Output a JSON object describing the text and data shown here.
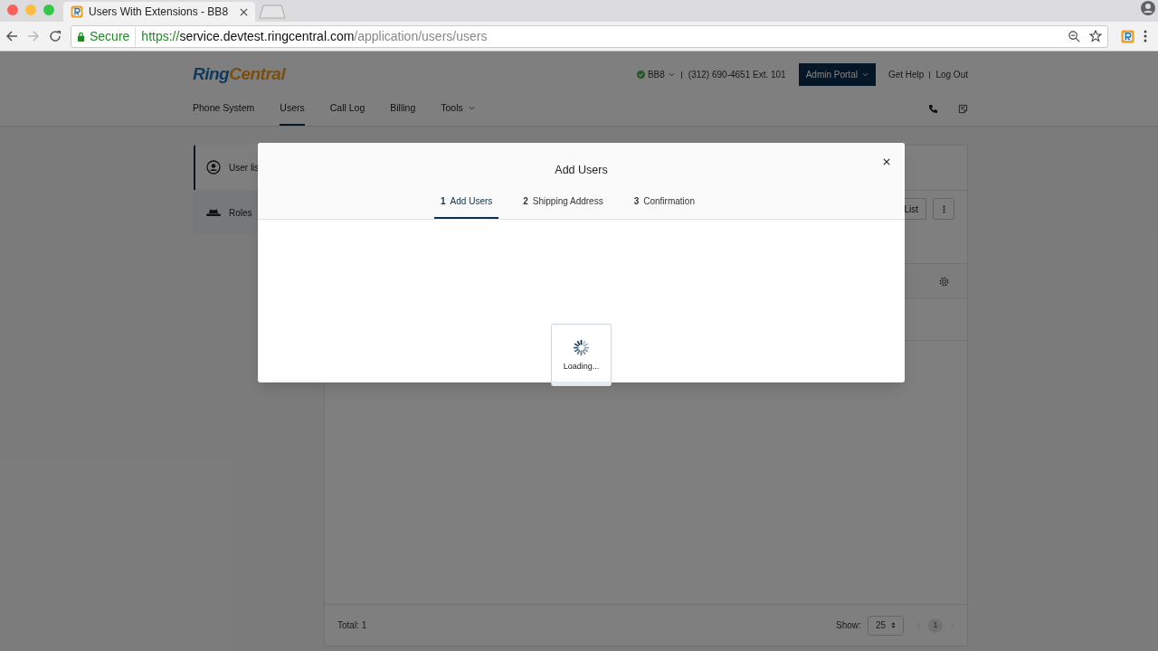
{
  "browser": {
    "tab_title": "Users With Extensions - BB8",
    "secure": "Secure",
    "url_host": "https://service.devtest.ringcentral.com",
    "url_path": "/application/users/users"
  },
  "header": {
    "logo": [
      "Ring",
      "Central"
    ],
    "account": "BB8",
    "phone": "(312) 690-4651 Ext. 101",
    "portal_button": "Admin Portal",
    "links": [
      "Get Help",
      "Log Out"
    ]
  },
  "nav": [
    {
      "label": "Phone System",
      "selected": false,
      "has_menu": false
    },
    {
      "label": "Users",
      "selected": true,
      "has_menu": false
    },
    {
      "label": "Call Log",
      "selected": false,
      "has_menu": false
    },
    {
      "label": "Billing",
      "selected": false,
      "has_menu": false
    },
    {
      "label": "Tools",
      "selected": false,
      "has_menu": true
    }
  ],
  "sidebar": [
    {
      "label": "User lis",
      "selected": true
    },
    {
      "label": "Roles",
      "selected": false
    }
  ],
  "toolbar": {
    "list_button": "List"
  },
  "footer": {
    "total": "Total: 1",
    "show_label": "Show:",
    "page_size": "25",
    "page": "1"
  },
  "modal": {
    "title": "Add Users",
    "steps": [
      {
        "number": "1",
        "label": "Add Users",
        "selected": true
      },
      {
        "number": "2",
        "label": "Shipping Address",
        "selected": false
      },
      {
        "number": "3",
        "label": "Confirmation",
        "selected": false
      }
    ],
    "loading": "Loading..."
  }
}
